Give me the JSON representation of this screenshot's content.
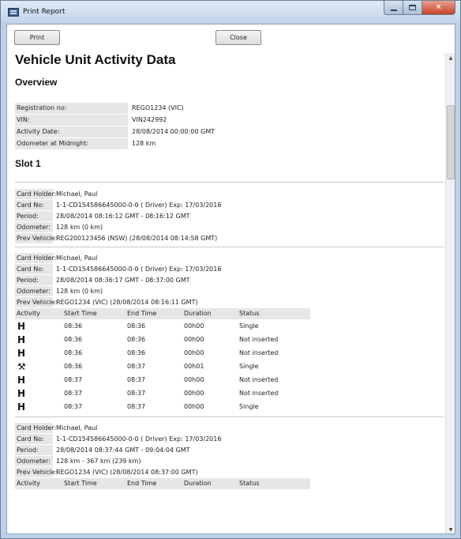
{
  "window": {
    "title": "Print Report"
  },
  "toolbar": {
    "print_label": "Print",
    "close_label": "Close"
  },
  "report": {
    "title": "Vehicle Unit Activity Data",
    "overview_heading": "Overview",
    "overview": [
      {
        "label": "Registration no:",
        "value": "REGO1234 (VIC)"
      },
      {
        "label": "VIN:",
        "value": "VIN242992"
      },
      {
        "label": "Activity Date:",
        "value": "28/08/2014 00:00:00 GMT"
      },
      {
        "label": "Odometer at Midnight:",
        "value": "128 km"
      }
    ],
    "slot_heading": "Slot 1",
    "field_labels": {
      "holder": "Card Holder:",
      "card_no": "Card No:",
      "period": "Period:",
      "odometer": "Odometer:",
      "prev_vehicle": "Prev Vehicle:"
    },
    "activity_headers": [
      "Activity",
      "Start Time",
      "End Time",
      "Duration",
      "Status"
    ],
    "cards": [
      {
        "holder": "Michael, Paul",
        "card_no": "1-1-CD154586645000-0-0 ( Driver) Exp: 17/03/2016",
        "period": "28/08/2014 08:16:12 GMT - 08:16:12 GMT",
        "odometer": "128 km (0 km)",
        "prev_vehicle": "REG200123456 (NSW) (28/08/2014 08:14:58 GMT)"
      },
      {
        "holder": "Michael, Paul",
        "card_no": "1-1-CD154586645000-0-0 ( Driver) Exp: 17/03/2016",
        "period": "28/08/2014 08:36:17 GMT - 08:37:00 GMT",
        "odometer": "128 km (0 km)",
        "prev_vehicle": "REGO1234 (VIC) (28/08/2014 08:16:11 GMT)",
        "activities": [
          {
            "icon": "rest-icon",
            "glyph": "H",
            "start": "08:36",
            "end": "08:36",
            "duration": "00h00",
            "status": "Single"
          },
          {
            "icon": "rest-icon",
            "glyph": "H",
            "start": "08:36",
            "end": "08:36",
            "duration": "00h00",
            "status": "Not inserted"
          },
          {
            "icon": "rest-icon",
            "glyph": "H",
            "start": "08:36",
            "end": "08:36",
            "duration": "00h00",
            "status": "Not inserted"
          },
          {
            "icon": "work-icon",
            "glyph": "⚒",
            "start": "08:36",
            "end": "08:37",
            "duration": "00h01",
            "status": "Single"
          },
          {
            "icon": "rest-icon",
            "glyph": "H",
            "start": "08:37",
            "end": "08:37",
            "duration": "00h00",
            "status": "Not inserted"
          },
          {
            "icon": "rest-icon",
            "glyph": "H",
            "start": "08:37",
            "end": "08:37",
            "duration": "00h00",
            "status": "Not inserted"
          },
          {
            "icon": "rest-icon",
            "glyph": "H",
            "start": "08:37",
            "end": "08:37",
            "duration": "00h00",
            "status": "Single"
          }
        ]
      },
      {
        "holder": "Michael, Paul",
        "card_no": "1-1-CD154586645000-0-0 ( Driver) Exp: 17/03/2016",
        "period": "28/08/2014 08:37:44 GMT - 09:04:04 GMT",
        "odometer": "128 km - 367 km (239 km)",
        "prev_vehicle": "REGO1234 (VIC) (28/08/2014 08:37:00 GMT)",
        "activities": []
      }
    ]
  }
}
